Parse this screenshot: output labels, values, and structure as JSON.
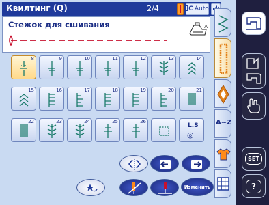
{
  "header": {
    "title": "Квилтинг (Q)",
    "pager": "2/4",
    "auto_label": "Auto",
    "title_bg": "#1f3a9b"
  },
  "preview": {
    "stitch_name": "Стежок для сшивания",
    "presser_foot_letter": "A",
    "line_color": "#c8102e"
  },
  "stitches": [
    {
      "num": "8",
      "icon": "quilting-hand-look-stitch-icon",
      "selected": true
    },
    {
      "num": "9",
      "icon": "quilting-stitch-icon"
    },
    {
      "num": "10",
      "icon": "quilting-stitch-icon"
    },
    {
      "num": "11",
      "icon": "quilting-stitch-icon"
    },
    {
      "num": "12",
      "icon": "quilting-stitch-icon"
    },
    {
      "num": "13",
      "icon": "feather-stitch-icon"
    },
    {
      "num": "14",
      "icon": "chevron-stitch-icon"
    },
    {
      "num": "15",
      "icon": "chevron-stitch-icon"
    },
    {
      "num": "16",
      "icon": "ladder-stitch-icon"
    },
    {
      "num": "17",
      "icon": "blanket-stitch-icon"
    },
    {
      "num": "18",
      "icon": "ladder-stitch-icon"
    },
    {
      "num": "19",
      "icon": "ladder-stitch-icon"
    },
    {
      "num": "20",
      "icon": "blanket-stitch-icon"
    },
    {
      "num": "21",
      "icon": "satin-stitch-icon"
    },
    {
      "num": "22",
      "icon": "satin-stitch-icon"
    },
    {
      "num": "23",
      "icon": "feather-stitch-icon"
    },
    {
      "num": "24",
      "icon": "feather-stitch-icon"
    },
    {
      "num": "25",
      "icon": "cross-stitch-icon"
    },
    {
      "num": "26",
      "icon": "cross-stitch-icon"
    },
    {
      "num": "",
      "icon": "stitch-square-icon"
    },
    {
      "num": "",
      "icon": "ls-stitch-icon",
      "label_top": "L.S",
      "label_bottom": "◎"
    }
  ],
  "bottom_buttons": {
    "modify_label": "Изменить"
  },
  "tabs": [
    {
      "icon": "stitch-tab-icon"
    },
    {
      "icon": "satin-tab-icon",
      "active": true
    },
    {
      "icon": "decorative-tab-icon"
    },
    {
      "icon": "alphabet-tab-icon",
      "label": "A~Z"
    },
    {
      "icon": "shirt-tab-icon"
    },
    {
      "icon": "grid-tab-icon"
    }
  ],
  "sidebar": [
    {
      "icon": "sewing-machine-icon",
      "active": true
    },
    {
      "icon": "embroidery-mode-icon"
    },
    {
      "icon": "hand-edit-icon"
    },
    {
      "icon": "set-icon",
      "label": "SET"
    },
    {
      "icon": "help-icon",
      "label": "?"
    }
  ]
}
